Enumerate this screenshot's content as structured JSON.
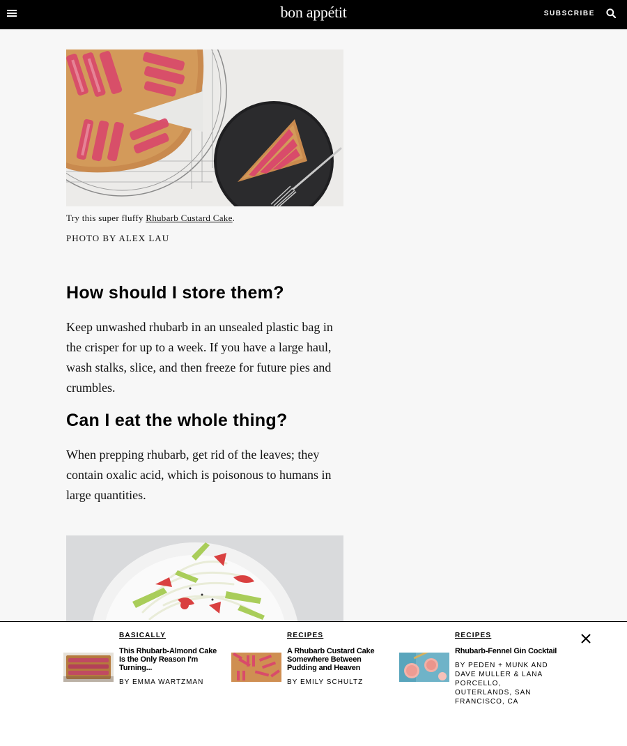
{
  "header": {
    "logo": "bon appétit",
    "subscribe_label": "SUBSCRIBE",
    "icons": {
      "menu": "hamburger-menu-icon",
      "search": "search-icon"
    }
  },
  "article": {
    "caption_prefix": "Try this super fluffy ",
    "caption_link": "Rhubarb Custard Cake",
    "caption_suffix": ".",
    "photo_credit": "PHOTO BY ALEX LAU",
    "sections": [
      {
        "heading": "How should I store them?",
        "body": "Keep unwashed rhubarb in an unsealed plastic bag in the crisper for up to a week. If you have a large haul, wash stalks, slice, and then freeze for future pies and crumbles."
      },
      {
        "heading": "Can I eat the whole thing?",
        "body": "When prepping rhubarb, get rid of the leaves; they contain oxalic acid, which is poisonous to humans in large quantities."
      }
    ]
  },
  "recirc": {
    "cards": [
      {
        "kicker": "BASICALLY",
        "title": "This Rhubarb-Almond Cake Is the Only Reason I'm Turning...",
        "byline": "BY EMMA WARTZMAN"
      },
      {
        "kicker": "RECIPES",
        "title": "A Rhubarb Custard Cake Somewhere Between Pudding and Heaven",
        "byline": "BY EMILY SCHULTZ"
      },
      {
        "kicker": "RECIPES",
        "title": "Rhubarb-Fennel Gin Cocktail",
        "byline": "BY PEDEN + MUNK AND DAVE MULLER & LANA PORCELLO, OUTERLANDS, SAN FRANCISCO, CA"
      }
    ],
    "close_icon": "close-icon"
  },
  "colors": {
    "topbar": "#000000",
    "page_background": "#f7f7f7",
    "rhubarb_pink": "#d94b6a",
    "cake_crust": "#c98a4e"
  }
}
